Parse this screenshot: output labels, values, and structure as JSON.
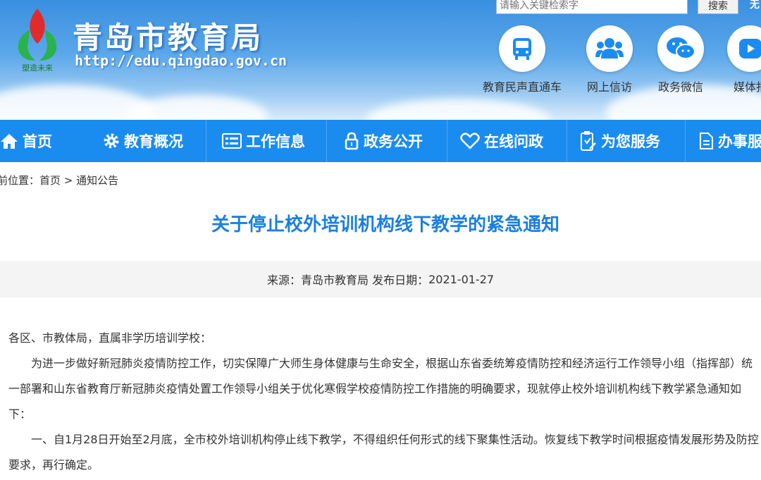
{
  "header": {
    "logo_caption": "塑造未来",
    "site_title": "青岛市教育局",
    "site_url": "http://edu.qingdao.gov.cn",
    "search_placeholder": "请输入关键检索字",
    "search_button": "搜索",
    "top_link": "无",
    "quick_links": [
      {
        "label": "教育民声直通车",
        "icon": "bus-icon"
      },
      {
        "label": "网上信访",
        "icon": "people-icon"
      },
      {
        "label": "政务微信",
        "icon": "wechat-icon"
      },
      {
        "label": "媒体报",
        "icon": "media-icon"
      }
    ]
  },
  "nav": {
    "items": [
      {
        "label": "首页",
        "icon": "home-icon"
      },
      {
        "label": "教育概况",
        "icon": "gear-icon"
      },
      {
        "label": "工作信息",
        "icon": "list-icon"
      },
      {
        "label": "政务公开",
        "icon": "lock-icon"
      },
      {
        "label": "在线问政",
        "icon": "heart-icon"
      },
      {
        "label": "为您服务",
        "icon": "service-icon"
      },
      {
        "label": "办事服",
        "icon": "document-icon"
      }
    ]
  },
  "breadcrumb": {
    "prefix": "前位置：",
    "home": "首页",
    "separator": " > ",
    "current": "通知公告"
  },
  "article": {
    "title": "关于停止校外培训机构线下教学的紧急通知",
    "source_label": "来源：",
    "source": "青岛市教育局",
    "date_label": "发布日期：",
    "date": "2021-01-27",
    "salutation": "各区、市教体局，直属非学历培训学校：",
    "paragraph1": "为进一步做好新冠肺炎疫情防控工作，切实保障广大师生身体健康与生命安全，根据山东省委统筹疫情防控和经济运行工作领导小组（指挥部）统一部署和山东省教育厅新冠肺炎疫情处置工作领导小组关于优化寒假学校疫情防控工作措施的明确要求，现就停止校外培训机构线下教学紧急通知如下：",
    "paragraph2": "一、自1月28日开始至2月底，全市校外培训机构停止线下教学，不得组织任何形式的线下聚集性活动。恢复线下教学时间根据疫情发展形势及防控要求，再行确定。"
  },
  "colors": {
    "nav_bg": "#1a8cf0",
    "title_blue": "#1a7fe0",
    "icon_blue": "#1a8cf0"
  }
}
